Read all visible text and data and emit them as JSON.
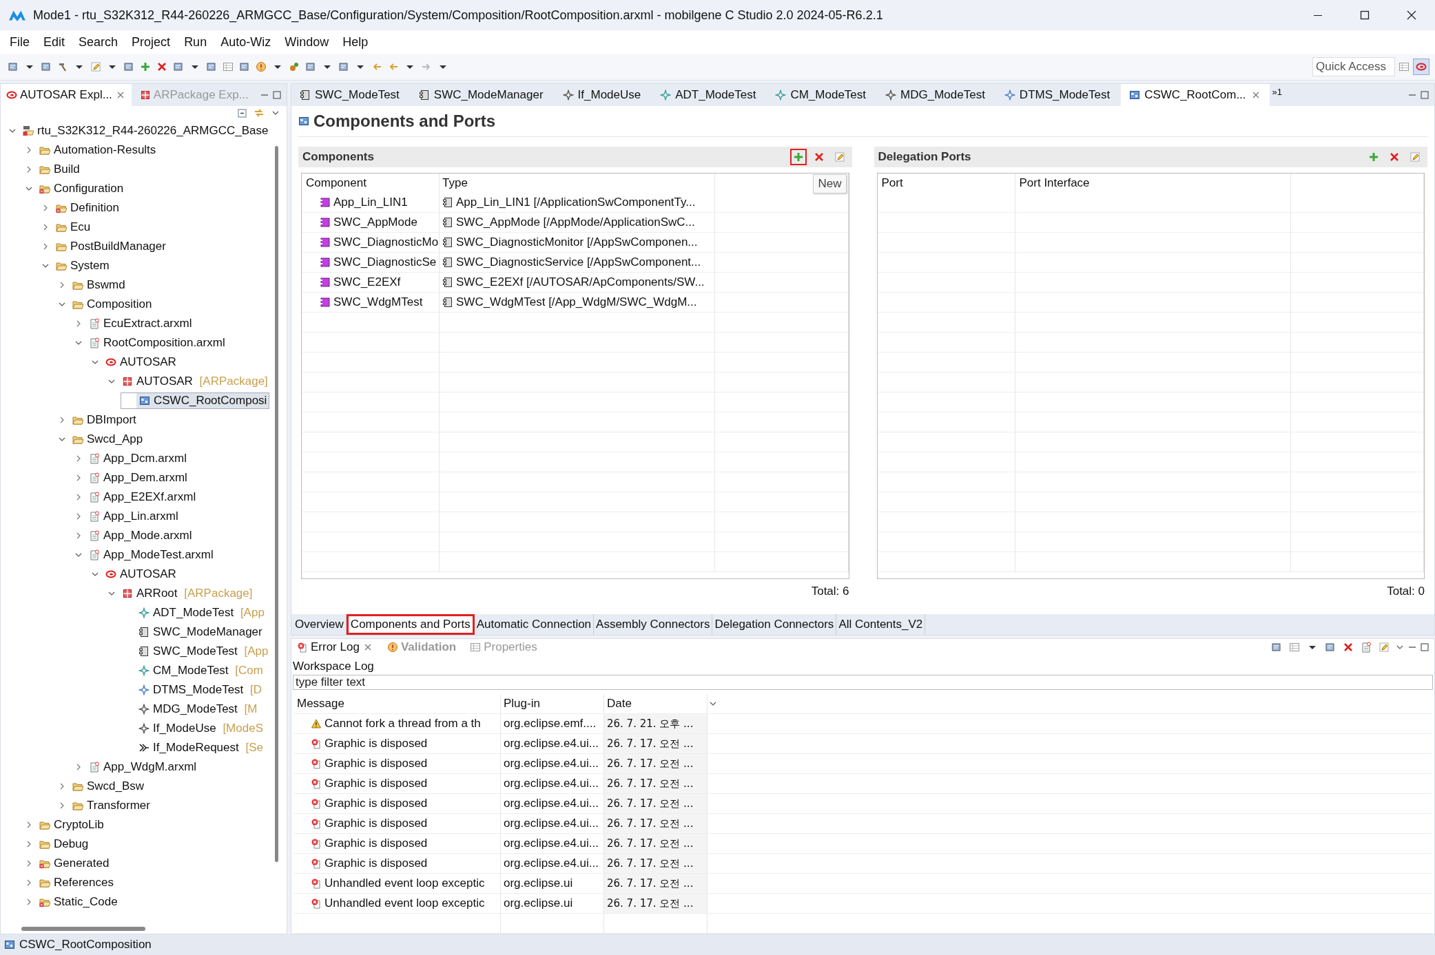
{
  "window": {
    "title": "Mode1 - rtu_S32K312_R44-260226_ARMGCC_Base/Configuration/System/Composition/RootComposition.arxml - mobilgene C Studio 2.0 2024-05-R6.2.1"
  },
  "menu": [
    "File",
    "Edit",
    "Search",
    "Project",
    "Run",
    "Auto-Wiz",
    "Window",
    "Help"
  ],
  "quick_access": {
    "placeholder": "Quick Access"
  },
  "explorer_tabs": [
    {
      "label": "AUTOSAR Expl...",
      "selected": true
    },
    {
      "label": "ARPackage Exp...",
      "selected": false
    }
  ],
  "tree": [
    {
      "label": "rtu_S32K312_R44-260226_ARMGCC_Base",
      "kind": "project",
      "expanded": true,
      "selected": false,
      "children": [
        {
          "label": "Automation-Results",
          "kind": "folder",
          "expanded": false,
          "selected": false
        },
        {
          "label": "Build",
          "kind": "folder",
          "expanded": false,
          "selected": false
        },
        {
          "label": "Configuration",
          "kind": "folder-error",
          "expanded": true,
          "selected": false,
          "children": [
            {
              "label": "Definition",
              "kind": "folder-error",
              "expanded": false,
              "selected": false
            },
            {
              "label": "Ecu",
              "kind": "folder",
              "expanded": false,
              "selected": false
            },
            {
              "label": "PostBuildManager",
              "kind": "folder",
              "expanded": false,
              "selected": false
            },
            {
              "label": "System",
              "kind": "folder",
              "expanded": true,
              "selected": false,
              "children": [
                {
                  "label": "Bswmd",
                  "kind": "folder",
                  "expanded": false,
                  "selected": false
                },
                {
                  "label": "Composition",
                  "kind": "folder",
                  "expanded": true,
                  "selected": false,
                  "children": [
                    {
                      "label": "EcuExtract.arxml",
                      "kind": "file",
                      "expanded": false,
                      "selected": false
                    },
                    {
                      "label": "RootComposition.arxml",
                      "kind": "file",
                      "expanded": true,
                      "selected": false,
                      "children": [
                        {
                          "label": "AUTOSAR",
                          "kind": "autosar",
                          "expanded": true,
                          "selected": false,
                          "children": [
                            {
                              "label": "AUTOSAR",
                              "suffix": "[ARPackage]",
                              "kind": "package",
                              "expanded": true,
                              "selected": false,
                              "children": [
                                {
                                  "label": "CSWC_RootComposi",
                                  "kind": "composition",
                                  "selected": true
                                }
                              ]
                            }
                          ]
                        }
                      ]
                    }
                  ]
                },
                {
                  "label": "DBImport",
                  "kind": "folder",
                  "expanded": false,
                  "selected": false
                },
                {
                  "label": "Swcd_App",
                  "kind": "folder",
                  "expanded": true,
                  "selected": false,
                  "children": [
                    {
                      "label": "App_Dcm.arxml",
                      "kind": "file",
                      "expanded": false,
                      "selected": false
                    },
                    {
                      "label": "App_Dem.arxml",
                      "kind": "file",
                      "expanded": false,
                      "selected": false
                    },
                    {
                      "label": "App_E2EXf.arxml",
                      "kind": "file",
                      "expanded": false,
                      "selected": false
                    },
                    {
                      "label": "App_Lin.arxml",
                      "kind": "file",
                      "expanded": false,
                      "selected": false
                    },
                    {
                      "label": "App_Mode.arxml",
                      "kind": "file",
                      "expanded": false,
                      "selected": false
                    },
                    {
                      "label": "App_ModeTest.arxml",
                      "kind": "file",
                      "expanded": true,
                      "selected": false,
                      "children": [
                        {
                          "label": "AUTOSAR",
                          "kind": "autosar",
                          "expanded": true,
                          "selected": false,
                          "children": [
                            {
                              "label": "ARRoot",
                              "suffix": "[ARPackage]",
                              "kind": "package",
                              "expanded": true,
                              "selected": false,
                              "children": [
                                {
                                  "label": "ADT_ModeTest",
                                  "suffix": "[App",
                                  "kind": "datatype",
                                  "selected": false
                                },
                                {
                                  "label": "SWC_ModeManager",
                                  "kind": "swc",
                                  "selected": false
                                },
                                {
                                  "label": "SWC_ModeTest",
                                  "suffix": "[App",
                                  "kind": "swc",
                                  "selected": false
                                },
                                {
                                  "label": "CM_ModeTest",
                                  "suffix": "[Com",
                                  "kind": "datatype",
                                  "selected": false
                                },
                                {
                                  "label": "DTMS_ModeTest",
                                  "suffix": "[D",
                                  "kind": "mapping",
                                  "selected": false
                                },
                                {
                                  "label": "MDG_ModeTest",
                                  "suffix": "[M",
                                  "kind": "interface",
                                  "selected": false
                                },
                                {
                                  "label": "If_ModeUse",
                                  "suffix": "[ModeS",
                                  "kind": "interface",
                                  "selected": false
                                },
                                {
                                  "label": "If_ModeRequest",
                                  "suffix": "[Se",
                                  "kind": "sender",
                                  "selected": false
                                }
                              ]
                            }
                          ]
                        }
                      ]
                    },
                    {
                      "label": "App_WdgM.arxml",
                      "kind": "file",
                      "expanded": false,
                      "selected": false
                    }
                  ]
                },
                {
                  "label": "Swcd_Bsw",
                  "kind": "folder",
                  "expanded": false,
                  "selected": false
                },
                {
                  "label": "Transformer",
                  "kind": "folder",
                  "expanded": false,
                  "selected": false
                }
              ]
            }
          ]
        },
        {
          "label": "CryptoLib",
          "kind": "folder",
          "expanded": false,
          "selected": false
        },
        {
          "label": "Debug",
          "kind": "folder",
          "expanded": false,
          "selected": false
        },
        {
          "label": "Generated",
          "kind": "folder-error",
          "expanded": false,
          "selected": false
        },
        {
          "label": "References",
          "kind": "folder",
          "expanded": false,
          "selected": false
        },
        {
          "label": "Static_Code",
          "kind": "folder-error",
          "expanded": false,
          "selected": false
        }
      ]
    }
  ],
  "editor_tabs": [
    {
      "label": "SWC_ModeTest",
      "kind": "swc",
      "selected": false
    },
    {
      "label": "SWC_ModeManager",
      "kind": "swc",
      "selected": false
    },
    {
      "label": "If_ModeUse",
      "kind": "interface",
      "selected": false
    },
    {
      "label": "ADT_ModeTest",
      "kind": "datatype",
      "selected": false
    },
    {
      "label": "CM_ModeTest",
      "kind": "datatype",
      "selected": false
    },
    {
      "label": "MDG_ModeTest",
      "kind": "interface",
      "selected": false
    },
    {
      "label": "DTMS_ModeTest",
      "kind": "mapping",
      "selected": false
    },
    {
      "label": "CSWC_RootCom...",
      "kind": "composition",
      "selected": true
    }
  ],
  "more_tabs": "»1",
  "page_title": "Components and Ports",
  "components": {
    "title": "Components",
    "tooltip": "New",
    "columns": [
      "Component",
      "Type"
    ],
    "rows": [
      {
        "component": "App_Lin_LIN1",
        "type": "App_Lin_LIN1 [/ApplicationSwComponentTy..."
      },
      {
        "component": "SWC_AppMode",
        "type": "SWC_AppMode [/AppMode/ApplicationSwC..."
      },
      {
        "component": "SWC_DiagnosticMo",
        "type": "SWC_DiagnosticMonitor [/AppSwComponen..."
      },
      {
        "component": "SWC_DiagnosticSe",
        "type": "SWC_DiagnosticService [/AppSwComponent..."
      },
      {
        "component": "SWC_E2EXf",
        "type": "SWC_E2EXf [/AUTOSAR/ApComponents/SW..."
      },
      {
        "component": "SWC_WdgMTest",
        "type": "SWC_WdgMTest [/App_WdgM/SWC_WdgM..."
      }
    ],
    "total": "Total: 6"
  },
  "delegation_ports": {
    "title": "Delegation Ports",
    "columns": [
      "Port",
      "Port Interface"
    ],
    "total": "Total: 0"
  },
  "page_tabs": [
    {
      "label": "Overview",
      "selected": false
    },
    {
      "label": "Components and Ports",
      "selected": true
    },
    {
      "label": "Automatic Connection",
      "selected": false
    },
    {
      "label": "Assembly Connectors",
      "selected": false
    },
    {
      "label": "Delegation Connectors",
      "selected": false
    },
    {
      "label": "All Contents_V2",
      "selected": false
    }
  ],
  "log_tabs": [
    {
      "label": "Error Log",
      "kind": "error-log",
      "selected": true
    },
    {
      "label": "Validation",
      "kind": "validation",
      "selected": false
    },
    {
      "label": "Properties",
      "kind": "properties",
      "selected": false
    }
  ],
  "log": {
    "scope": "Workspace Log",
    "filter": {
      "placeholder": "type filter text"
    },
    "columns": [
      "Message",
      "Plug-in",
      "Date"
    ],
    "rows": [
      {
        "kind": "warning",
        "message": "Cannot fork a thread from a th",
        "plugin": "org.eclipse.emf....",
        "date": "26. 7. 21. 오후 ..."
      },
      {
        "kind": "error",
        "message": "Graphic is disposed",
        "plugin": "org.eclipse.e4.ui...",
        "date": "26. 7. 17. 오전 ..."
      },
      {
        "kind": "error",
        "message": "Graphic is disposed",
        "plugin": "org.eclipse.e4.ui...",
        "date": "26. 7. 17. 오전 ..."
      },
      {
        "kind": "error",
        "message": "Graphic is disposed",
        "plugin": "org.eclipse.e4.ui...",
        "date": "26. 7. 17. 오전 ..."
      },
      {
        "kind": "error",
        "message": "Graphic is disposed",
        "plugin": "org.eclipse.e4.ui...",
        "date": "26. 7. 17. 오전 ..."
      },
      {
        "kind": "error",
        "message": "Graphic is disposed",
        "plugin": "org.eclipse.e4.ui...",
        "date": "26. 7. 17. 오전 ..."
      },
      {
        "kind": "error",
        "message": "Graphic is disposed",
        "plugin": "org.eclipse.e4.ui...",
        "date": "26. 7. 17. 오전 ..."
      },
      {
        "kind": "error",
        "message": "Graphic is disposed",
        "plugin": "org.eclipse.e4.ui...",
        "date": "26. 7. 17. 오전 ..."
      },
      {
        "kind": "error",
        "message": "Unhandled event loop exceptic",
        "plugin": "org.eclipse.ui",
        "date": "26. 7. 17. 오전 ..."
      },
      {
        "kind": "error",
        "message": "Unhandled event loop exceptic",
        "plugin": "org.eclipse.ui",
        "date": "26. 7. 17. 오전 ..."
      }
    ]
  },
  "status_bar": {
    "text": "CSWC_RootComposition"
  }
}
